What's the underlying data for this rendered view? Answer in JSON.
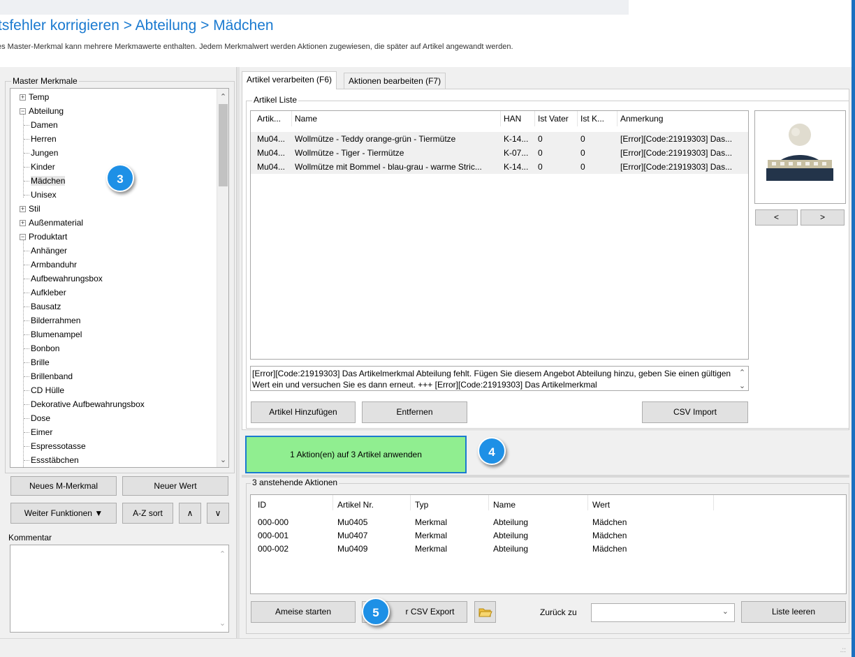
{
  "header": {
    "title": "tsfehler korrigieren > Abteilung > Mädchen",
    "subtitle": "es Master-Merkmal kann mehrere Merkmawerte enthalten. Jedem Merkmalwert werden Aktionen zugewiesen, die später auf Artikel angewandt werden."
  },
  "left_panel": {
    "group_label": "Master Merkmale",
    "tree": [
      {
        "label": "Temp",
        "level": 0,
        "expander": "+"
      },
      {
        "label": "Abteilung",
        "level": 0,
        "expander": "-"
      },
      {
        "label": "Damen",
        "level": 1
      },
      {
        "label": "Herren",
        "level": 1
      },
      {
        "label": "Jungen",
        "level": 1
      },
      {
        "label": "Kinder",
        "level": 1
      },
      {
        "label": "Mädchen",
        "level": 1,
        "selected": true
      },
      {
        "label": "Unisex",
        "level": 1
      },
      {
        "label": "Stil",
        "level": 0,
        "expander": "+"
      },
      {
        "label": "Außenmaterial",
        "level": 0,
        "expander": "+"
      },
      {
        "label": "Produktart",
        "level": 0,
        "expander": "-"
      },
      {
        "label": "Anhänger",
        "level": 1
      },
      {
        "label": "Armbanduhr",
        "level": 1
      },
      {
        "label": "Aufbewahrungsbox",
        "level": 1
      },
      {
        "label": "Aufkleber",
        "level": 1
      },
      {
        "label": "Bausatz",
        "level": 1
      },
      {
        "label": "Bilderrahmen",
        "level": 1
      },
      {
        "label": "Blumenampel",
        "level": 1
      },
      {
        "label": "Bonbon",
        "level": 1
      },
      {
        "label": "Brille",
        "level": 1
      },
      {
        "label": "Brillenband",
        "level": 1
      },
      {
        "label": "CD Hülle",
        "level": 1
      },
      {
        "label": "Dekorative Aufbewahrungsbox",
        "level": 1
      },
      {
        "label": "Dose",
        "level": 1
      },
      {
        "label": "Eimer",
        "level": 1
      },
      {
        "label": "Espressotasse",
        "level": 1
      },
      {
        "label": "Essstäbchen",
        "level": 1
      }
    ],
    "buttons": {
      "new_master": "Neues M-Merkmal",
      "new_value": "Neuer Wert",
      "more_functions": "Weiter Funktionen",
      "az_sort": "A-Z sort",
      "up": "∧",
      "down": "∨"
    },
    "comment_label": "Kommentar"
  },
  "tabs": [
    {
      "label": "Artikel verarbeiten (F6)",
      "active": true
    },
    {
      "label": "Aktionen bearbeiten (F7)",
      "active": false
    }
  ],
  "article_list": {
    "group_label": "Artikel Liste",
    "columns": [
      "Artik...",
      "Name",
      "HAN",
      "Ist Vater",
      "Ist K...",
      "Anmerkung"
    ],
    "rows": [
      [
        "Mu04...",
        "Wollmütze - Teddy orange-grün - Tiermütze",
        "K-14...",
        "0",
        "0",
        "[Error][Code:21919303] Das..."
      ],
      [
        "Mu04...",
        "Wollmütze - Tiger - Tiermütze",
        "K-07...",
        "0",
        "0",
        "[Error][Code:21919303] Das..."
      ],
      [
        "Mu04...",
        "Wollmütze mit Bommel - blau-grau - warme Stric...",
        "K-14...",
        "0",
        "0",
        "[Error][Code:21919303] Das..."
      ]
    ],
    "image_prev": "<",
    "image_next": ">",
    "error_text": "[Error][Code:21919303] Das Artikelmerkmal Abteilung fehlt. Fügen Sie diesem Angebot Abteilung hinzu, geben Sie einen gültigen Wert ein und versuchen Sie es dann erneut. +++ [Error][Code:21919303] Das Artikelmerkmal",
    "buttons": {
      "add": "Artikel Hinzufügen",
      "remove": "Entfernen",
      "csv_import": "CSV Import"
    }
  },
  "apply_button": "1  Aktion(en) auf 3 Artikel anwenden",
  "pending": {
    "group_label": "3 anstehende Aktionen",
    "columns": [
      "ID",
      "Artikel Nr.",
      "Typ",
      "Name",
      "Wert"
    ],
    "rows": [
      [
        "000-000",
        "Mu0405",
        "Merkmal",
        "Abteilung",
        "Mädchen"
      ],
      [
        "000-001",
        "Mu0407",
        "Merkmal",
        "Abteilung",
        "Mädchen"
      ],
      [
        "000-002",
        "Mu0409",
        "Merkmal",
        "Abteilung",
        "Mädchen"
      ]
    ],
    "buttons": {
      "start": "Ameise starten",
      "csv_export": "r CSV Export",
      "back_label": "Zurück zu",
      "back_value": "",
      "clear": "Liste leeren"
    }
  },
  "badges": [
    "3",
    "4",
    "5"
  ],
  "colors": {
    "accent": "#1a7ad0",
    "badge": "#1e90e6",
    "apply_bg": "#90ee90"
  }
}
